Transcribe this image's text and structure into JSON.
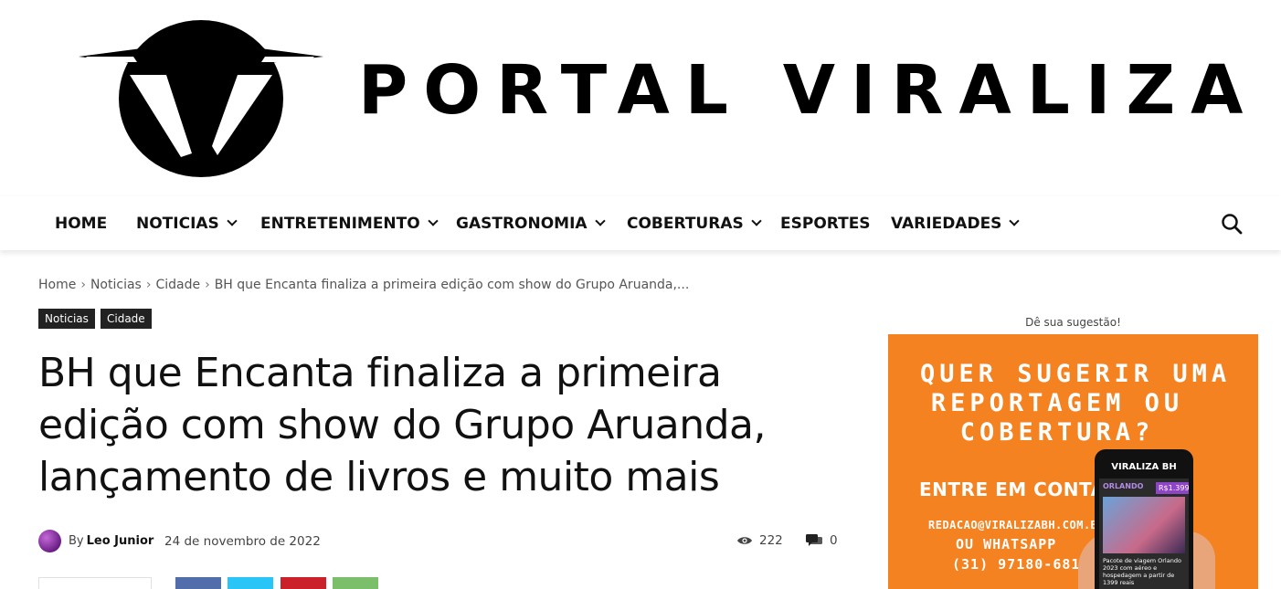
{
  "header": {
    "logo_text": "PORTAL VIRALIZA"
  },
  "nav": {
    "items": [
      {
        "label": "HOME",
        "dropdown": false
      },
      {
        "label": "NOTICIAS",
        "dropdown": true
      },
      {
        "label": "ENTRETENIMENTO",
        "dropdown": true
      },
      {
        "label": "GASTRONOMIA",
        "dropdown": true
      },
      {
        "label": "COBERTURAS",
        "dropdown": true
      },
      {
        "label": "ESPORTES",
        "dropdown": false
      },
      {
        "label": "VARIEDADES",
        "dropdown": true
      }
    ],
    "search_icon": "search-icon"
  },
  "breadcrumb": {
    "items": [
      "Home",
      "Noticias",
      "Cidade",
      "BH que Encanta finaliza a primeira edição com show do Grupo Aruanda,..."
    ],
    "separator": "›"
  },
  "tags": [
    "Noticias",
    "Cidade"
  ],
  "article": {
    "title": "BH que Encanta finaliza a primeira edição com show do Grupo Aruanda, lançamento de livros e muito mais",
    "by_label": "By",
    "author": "Leo Junior",
    "date": "24 de novembro de 2022",
    "views": "222",
    "comments": "0"
  },
  "sidebar": {
    "ad_label": "Dê sua sugestão!",
    "ad": {
      "headline": [
        "QUER SUGERIR UMA",
        "REPORTAGEM OU",
        "COBERTURA?"
      ],
      "contact": "ENTRE EM CONTATO:",
      "email": "REDACAO@VIRALIZABH.COM.BR",
      "or_text": "OU WHATSAPP",
      "phone": "(31) 97180-6813",
      "phone_brand": "VIRALIZA BH",
      "phone_tag": "ORLANDO",
      "phone_price": "R$1.399",
      "phone_news": "Pacote de viagem Orlando 2023 com aéreo e hospedagem a partir de 1399 reais"
    }
  },
  "colors": {
    "ad_background": "#f58220",
    "tag_background": "#222222",
    "share_facebook": "#516eab",
    "share_twitter": "#29c5f6",
    "share_pinterest": "#ca212a",
    "share_whatsapp": "#7bbf6a"
  }
}
